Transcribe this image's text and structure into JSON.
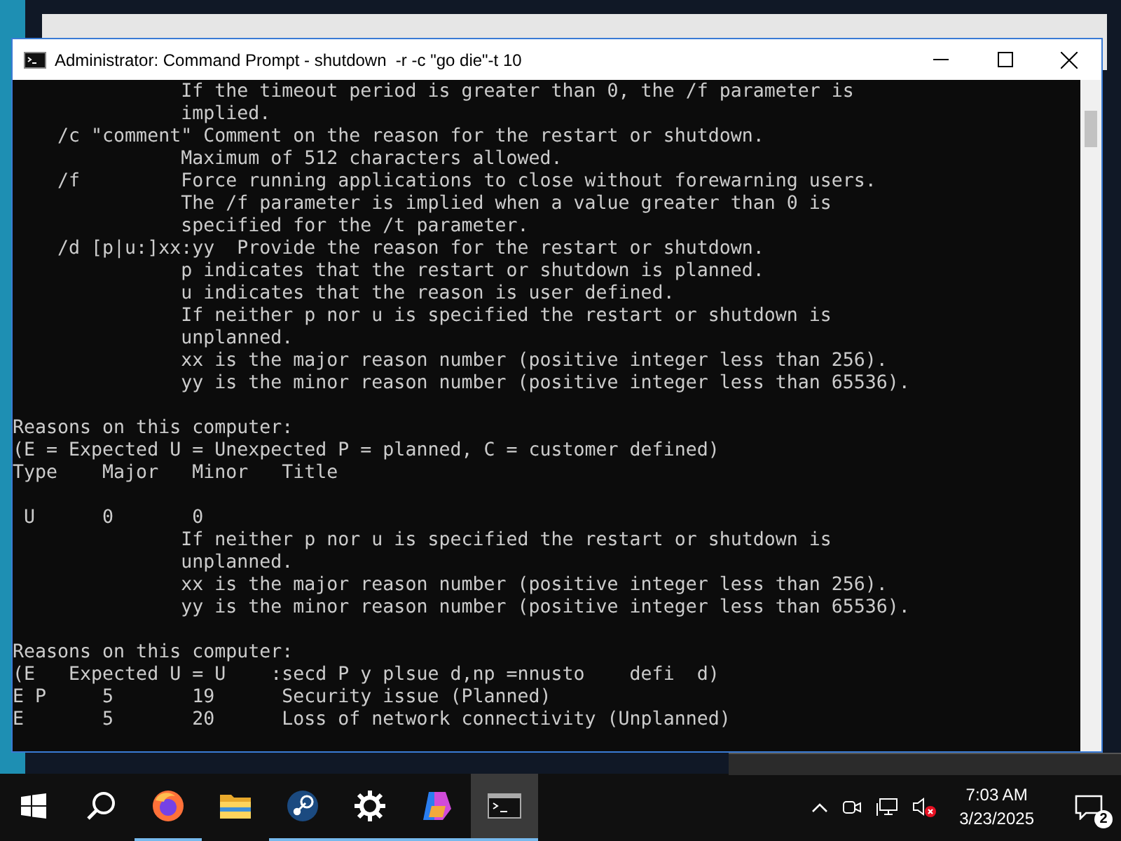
{
  "window": {
    "title": "Administrator: Command Prompt - shutdown  -r -c \"go die\"-t 10"
  },
  "console": {
    "blocks": [
      [
        "               If the timeout period is greater than 0, the /f parameter is",
        "               implied.",
        "    /c \"comment\" Comment on the reason for the restart or shutdown.",
        "               Maximum of 512 characters allowed.",
        "    /f         Force running applications to close without forewarning users.",
        "               The /f parameter is implied when a value greater than 0 is",
        "               specified for the /t parameter.",
        "    /d [p|u:]xx:yy  Provide the reason for the restart or shutdown.",
        "               p indicates that the restart or shutdown is planned.",
        "               u indicates that the reason is user defined.",
        "               If neither p nor u is specified the restart or shutdown is",
        "               unplanned.",
        "               xx is the major reason number (positive integer less than 256).",
        "               yy is the minor reason number (positive integer less than 65536)."
      ],
      [
        "Reasons on this computer:",
        "(E = Expected U = Unexpected P = planned, C = customer defined)",
        "Type    Major   Minor   Title"
      ],
      [
        " U      0       0",
        "               If neither p nor u is specified the restart or shutdown is",
        "               unplanned.",
        "               xx is the major reason number (positive integer less than 256).",
        "               yy is the minor reason number (positive integer less than 65536)."
      ],
      [
        "Reasons on this computer:",
        "(E   Expected U = U    :secd P y plsue d,np =nnusto    defi  d)",
        "E P     5       19      Security issue (Planned)",
        "E       5       20      Loss of network connectivity (Unplanned)"
      ]
    ]
  },
  "taskbar": {
    "apps": [
      {
        "kind": "start",
        "running": false,
        "selected": false
      },
      {
        "kind": "search",
        "running": false,
        "selected": false
      },
      {
        "kind": "firefox",
        "running": true,
        "selected": false
      },
      {
        "kind": "folder",
        "running": false,
        "selected": false
      },
      {
        "kind": "steam",
        "running": true,
        "selected": false
      },
      {
        "kind": "gear",
        "running": true,
        "selected": false
      },
      {
        "kind": "copilot",
        "running": true,
        "selected": false
      },
      {
        "kind": "terminal",
        "running": true,
        "selected": true
      }
    ],
    "time": "7:03 AM",
    "date": "3/23/2025",
    "notifications": "2"
  }
}
